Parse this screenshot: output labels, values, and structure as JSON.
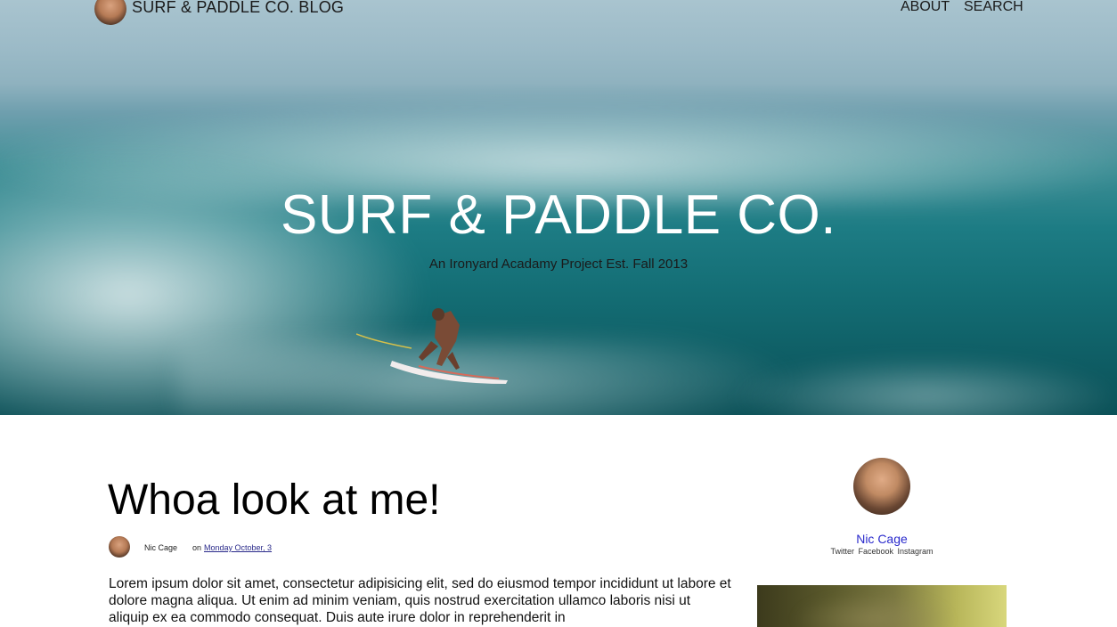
{
  "header": {
    "brand_title": "SURF & PADDLE CO. BLOG",
    "nav": [
      "ABOUT",
      "SEARCH"
    ]
  },
  "hero": {
    "title": "SURF & PADDLE CO.",
    "subtitle": "An Ironyard Acadamy Project Est. Fall 2013"
  },
  "post": {
    "title": "Whoa look at me!",
    "author": "Nic Cage",
    "on_label": "on",
    "date": "Monday October, 3",
    "body": "Lorem ipsum dolor sit amet, consectetur adipisicing elit, sed do eiusmod tempor incididunt ut labore et dolore magna aliqua. Ut enim ad minim veniam, quis nostrud exercitation ullamco laboris nisi ut aliquip ex ea commodo consequat. Duis aute irure dolor in reprehenderit in"
  },
  "sidebar": {
    "name": "Nic Cage",
    "social": [
      "Twitter",
      "Facebook",
      "Instagram"
    ]
  },
  "colors": {
    "link": "#2a2acc",
    "hero_text": "#ffffff"
  }
}
